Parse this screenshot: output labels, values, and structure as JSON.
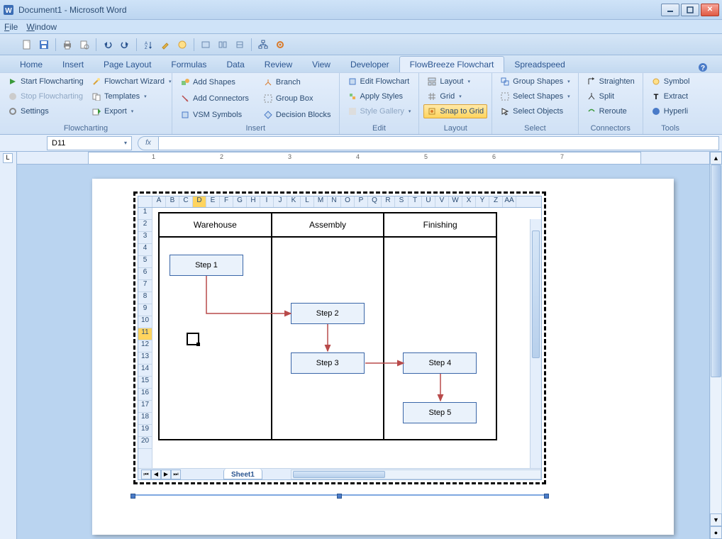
{
  "window": {
    "title": "Document1 - Microsoft Word"
  },
  "menubar": {
    "file": "File",
    "window": "Window"
  },
  "tabs": {
    "home": "Home",
    "insert": "Insert",
    "pagelayout": "Page Layout",
    "formulas": "Formulas",
    "data": "Data",
    "review": "Review",
    "view": "View",
    "developer": "Developer",
    "flowbreeze": "FlowBreeze Flowchart",
    "spreadspeed": "Spreadspeed"
  },
  "ribbon": {
    "flowcharting": {
      "label": "Flowcharting",
      "start": "Start Flowcharting",
      "stop": "Stop Flowcharting",
      "settings": "Settings",
      "wizard": "Flowchart Wizard",
      "templates": "Templates",
      "export": "Export"
    },
    "insert": {
      "label": "Insert",
      "addshapes": "Add Shapes",
      "addconnectors": "Add Connectors",
      "vsm": "VSM Symbols",
      "branch": "Branch",
      "groupbox": "Group Box",
      "decision": "Decision Blocks"
    },
    "edit": {
      "label": "Edit",
      "editflow": "Edit Flowchart",
      "applystyles": "Apply Styles",
      "stylegallery": "Style Gallery"
    },
    "layout": {
      "label": "Layout",
      "layout": "Layout",
      "grid": "Grid",
      "snap": "Snap to Grid"
    },
    "select": {
      "label": "Select",
      "groupshapes": "Group Shapes",
      "selectshapes": "Select Shapes",
      "selectobjects": "Select Objects"
    },
    "connectors": {
      "label": "Connectors",
      "straighten": "Straighten",
      "split": "Split",
      "reroute": "Reroute"
    },
    "tools": {
      "label": "Tools",
      "symbol": "Symbol",
      "extract": "Extract",
      "hyperlink": "Hyperli"
    }
  },
  "formulabar": {
    "cell_ref": "D11",
    "fx": "fx"
  },
  "ruler_label": "L",
  "ruler_ticks": [
    "1",
    "2",
    "3",
    "4",
    "5",
    "6",
    "7"
  ],
  "sheet": {
    "cols": [
      "A",
      "B",
      "C",
      "D",
      "E",
      "F",
      "G",
      "H",
      "I",
      "J",
      "K",
      "L",
      "M",
      "N",
      "O",
      "P",
      "Q",
      "R",
      "S",
      "T",
      "U",
      "V",
      "W",
      "X",
      "Y",
      "Z",
      "AA"
    ],
    "selected_col": "D",
    "rows": [
      "1",
      "2",
      "3",
      "4",
      "5",
      "6",
      "7",
      "8",
      "9",
      "10",
      "11",
      "12",
      "13",
      "14",
      "15",
      "16",
      "17",
      "18",
      "19",
      "20"
    ],
    "selected_row": "11",
    "tab": "Sheet1"
  },
  "swimlanes": {
    "headers": [
      "Warehouse",
      "Assembly",
      "Finishing"
    ],
    "steps": {
      "s1": "Step 1",
      "s2": "Step 2",
      "s3": "Step 3",
      "s4": "Step 4",
      "s5": "Step 5"
    }
  }
}
